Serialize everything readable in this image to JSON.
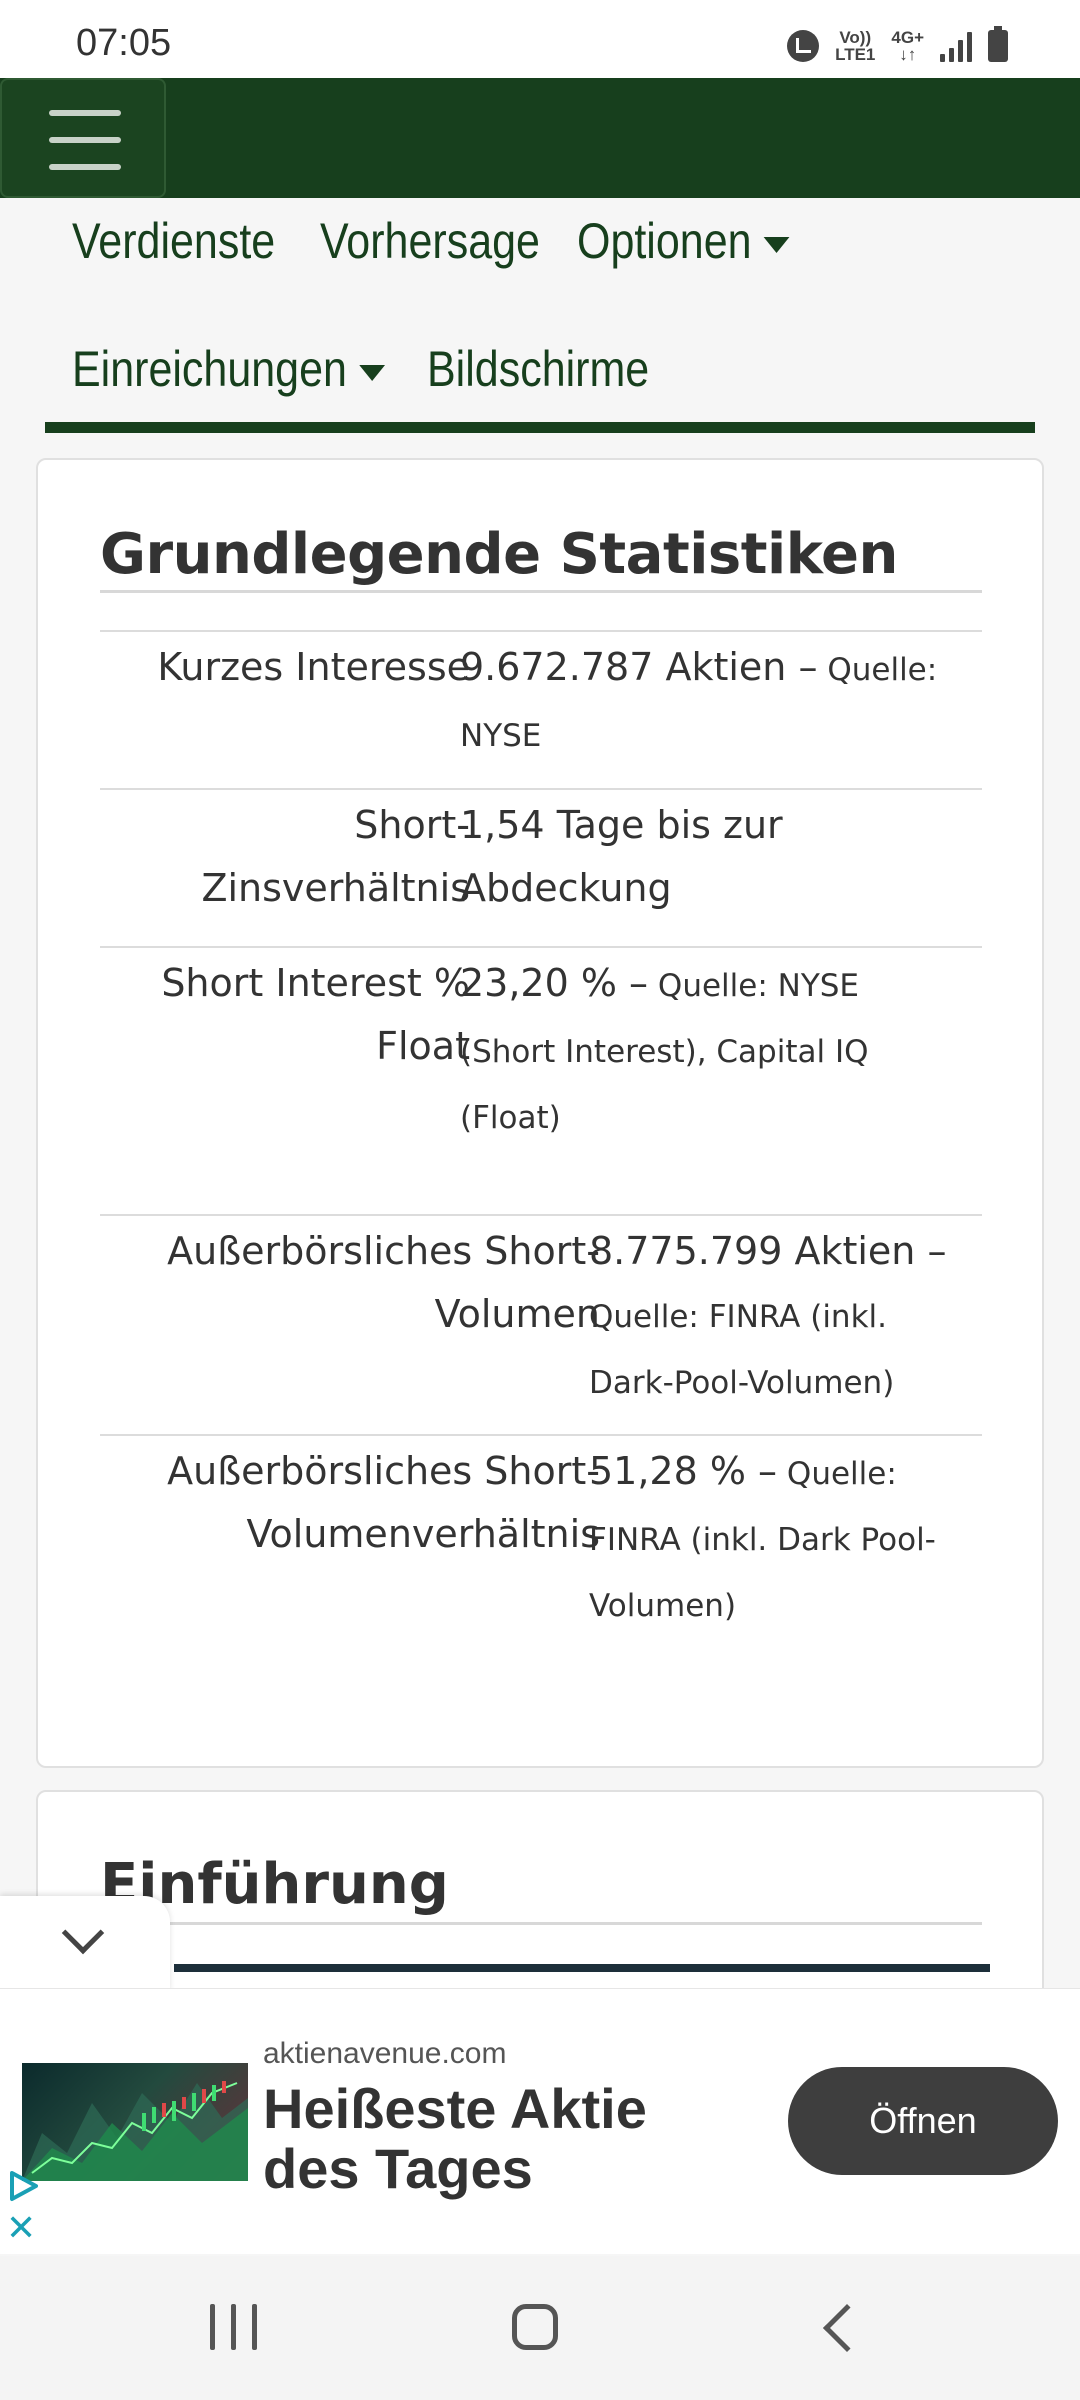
{
  "status_bar": {
    "time": "07:05",
    "network_line1": "Vo))",
    "network_line2": "LTE1",
    "network_type": "4G+",
    "icons": [
      "alarm-icon",
      "volte-icon",
      "data-icon",
      "signal-icon",
      "battery-icon"
    ]
  },
  "header": {
    "menu_icon": "hamburger-menu-icon",
    "brand_color": "#173f1d"
  },
  "nav": {
    "items": [
      {
        "label": "Verdienste",
        "dropdown": false
      },
      {
        "label": "Vorhersage",
        "dropdown": false
      },
      {
        "label": "Optionen",
        "dropdown": true
      },
      {
        "label": "Einreichungen",
        "dropdown": true
      },
      {
        "label": "Bildschirme",
        "dropdown": false
      }
    ]
  },
  "stats": {
    "title": "Grundlegende Statistiken",
    "rows": [
      {
        "label": "Kurzes Interesse",
        "value": "9.672.787 Aktien –",
        "source_lines": [
          " Quelle:",
          "NYSE"
        ]
      },
      {
        "label_lines": [
          "Short-",
          "Zinsverhältnis"
        ],
        "value_lines": [
          "1,54 Tage bis zur",
          "Abdeckung"
        ]
      },
      {
        "label_lines": [
          "Short Interest %",
          "Float"
        ],
        "value": "23,20 % –",
        "source_lines": [
          " Quelle: NYSE",
          "(Short Interest), Capital IQ",
          "(Float)"
        ]
      },
      {
        "label_lines": [
          "Außerbörsliches Short-",
          "Volumen"
        ],
        "value": "8.775.799 Aktien –",
        "source_lines": [
          "Quelle: FINRA (inkl.",
          "Dark-Pool-Volumen)"
        ]
      },
      {
        "label_lines": [
          "Außerbörsliches Short-",
          "Volumenverhältnis"
        ],
        "value": "51,28 % –",
        "source_lines": [
          " Quelle:",
          "FINRA (inkl. Dark Pool-",
          "Volumen)"
        ]
      }
    ]
  },
  "intro": {
    "title": "Einführung"
  },
  "collapse": {
    "icon": "chevron-down-icon"
  },
  "ad": {
    "domain": "aktienavenue.com",
    "headline": "Heißeste Aktie des Tages",
    "button": "Öffnen",
    "icons": [
      "adchoices-icon",
      "close-icon"
    ],
    "accent": "#1aa0b5"
  },
  "system_nav": {
    "icons": [
      "recent-apps-icon",
      "home-icon",
      "back-icon"
    ]
  }
}
